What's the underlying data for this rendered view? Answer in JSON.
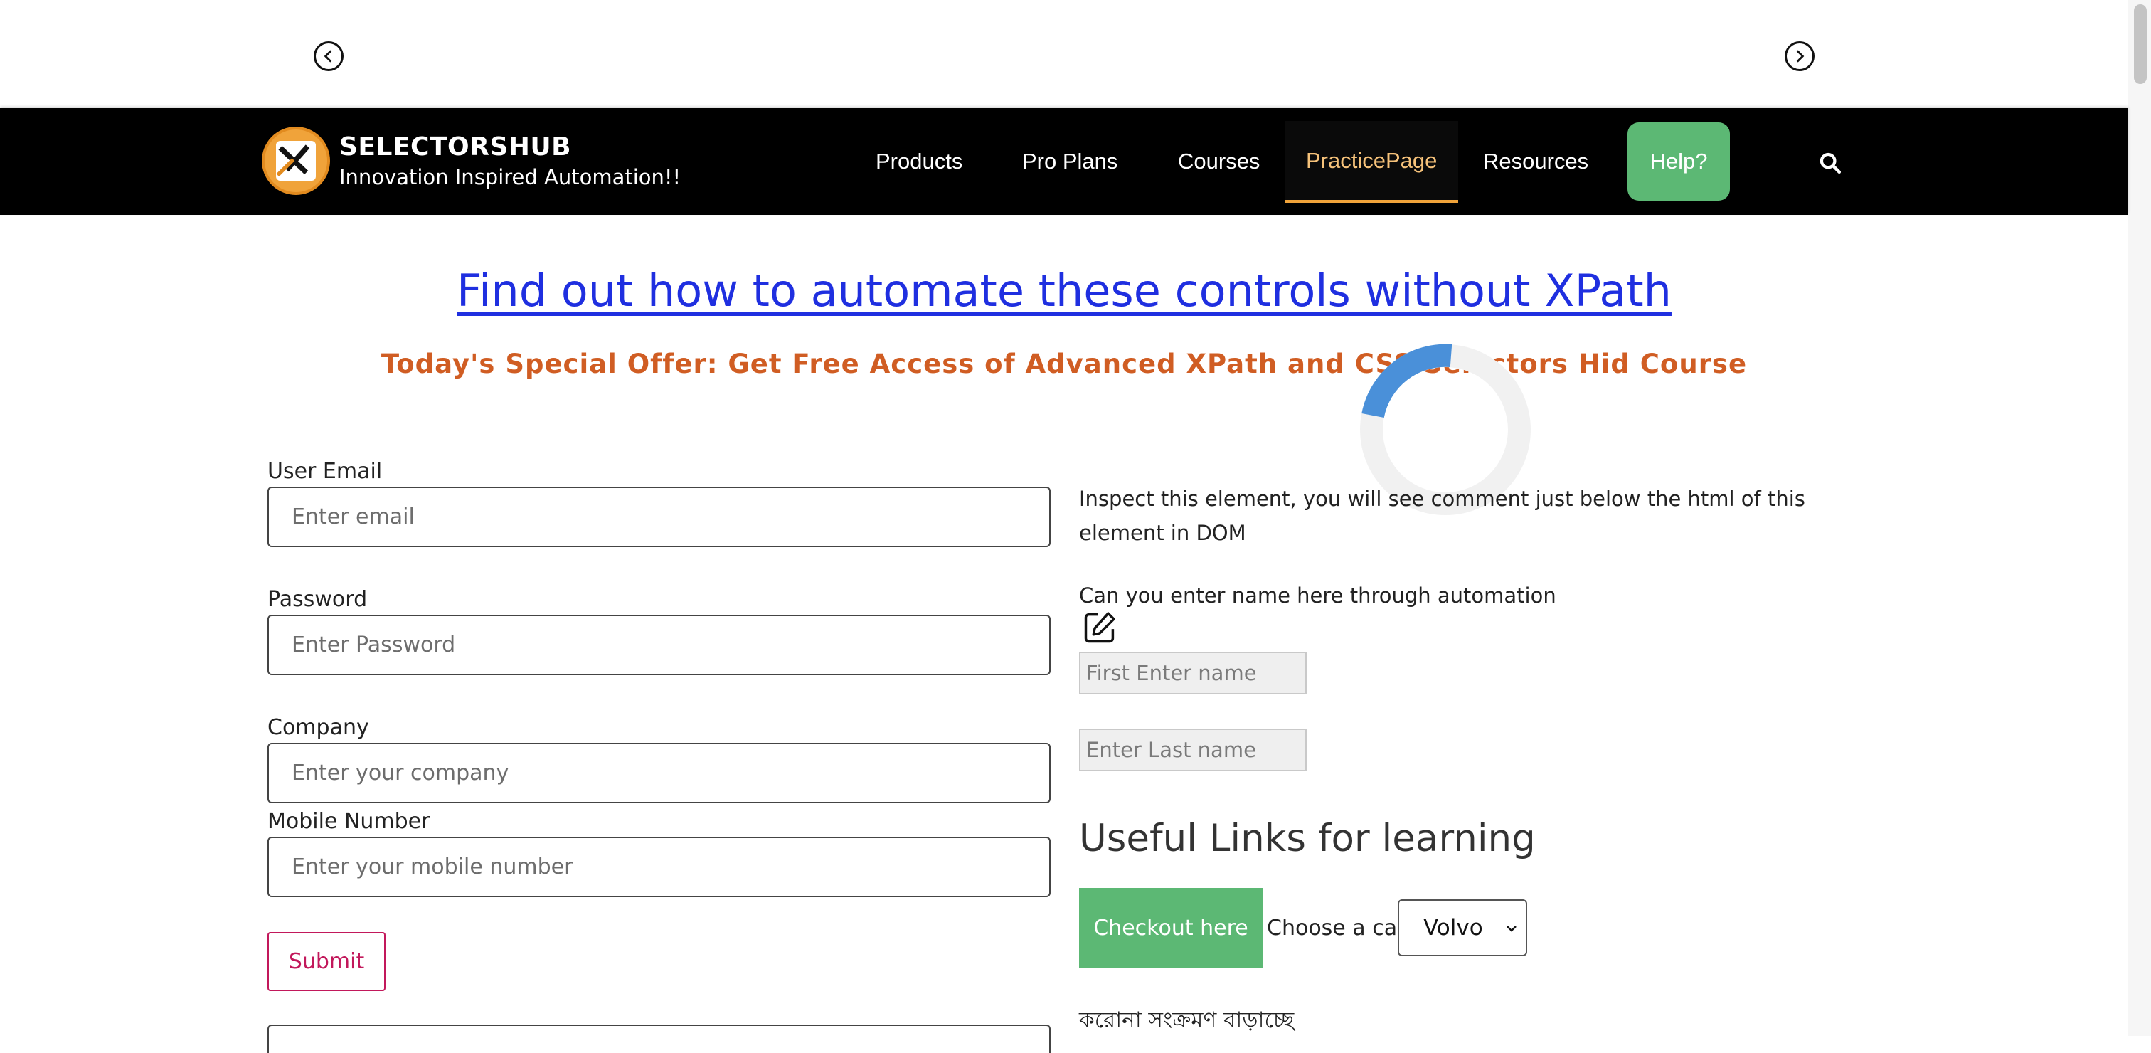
{
  "slider": {
    "prev_icon": "chevron-left-icon",
    "next_icon": "chevron-right-icon"
  },
  "header": {
    "brand_name": "SELECTORSHUB",
    "brand_tagline": "Innovation Inspired Automation!!",
    "nav": {
      "products": "Products",
      "pro_plans": "Pro Plans",
      "courses": "Courses",
      "practice_page": "PracticePage",
      "resources": "Resources"
    },
    "help_label": "Help?",
    "search_icon": "search-icon",
    "active_item": "PracticePage"
  },
  "banner": {
    "headline": "Find out how to automate these controls without XPath",
    "offer": "Today's Special Offer: Get Free Access of Advanced XPath and CSS Selectors Hid Course"
  },
  "form": {
    "email_label": "User Email",
    "email_placeholder": "Enter email",
    "password_label": "Password",
    "password_placeholder": "Enter Password",
    "company_label": "Company",
    "company_placeholder": "Enter your company",
    "mobile_label": "Mobile Number",
    "mobile_placeholder": "Enter your mobile number",
    "submit_label": "Submit"
  },
  "right": {
    "inspect_text": "Inspect this element, you will see comment just below the html of this element in DOM",
    "enter_name_text": "Can you enter name here through automation",
    "first_name_placeholder": "First Enter name",
    "last_name_placeholder": "Enter Last name",
    "useful_heading": "Useful Links for learning",
    "checkout_label": "Checkout here",
    "choose_car_label": "Choose a car:",
    "car_selected": "Volvo",
    "bengali_text": "করোনা সংক্রমণ বাড়াচ্ছে"
  },
  "colors": {
    "nav_bg": "#000000",
    "active_accent": "#f0a33a",
    "help_green": "#5cb874",
    "link_blue": "#1f2fe0",
    "offer_orange": "#d05d23",
    "submit_pink": "#c2185b"
  }
}
